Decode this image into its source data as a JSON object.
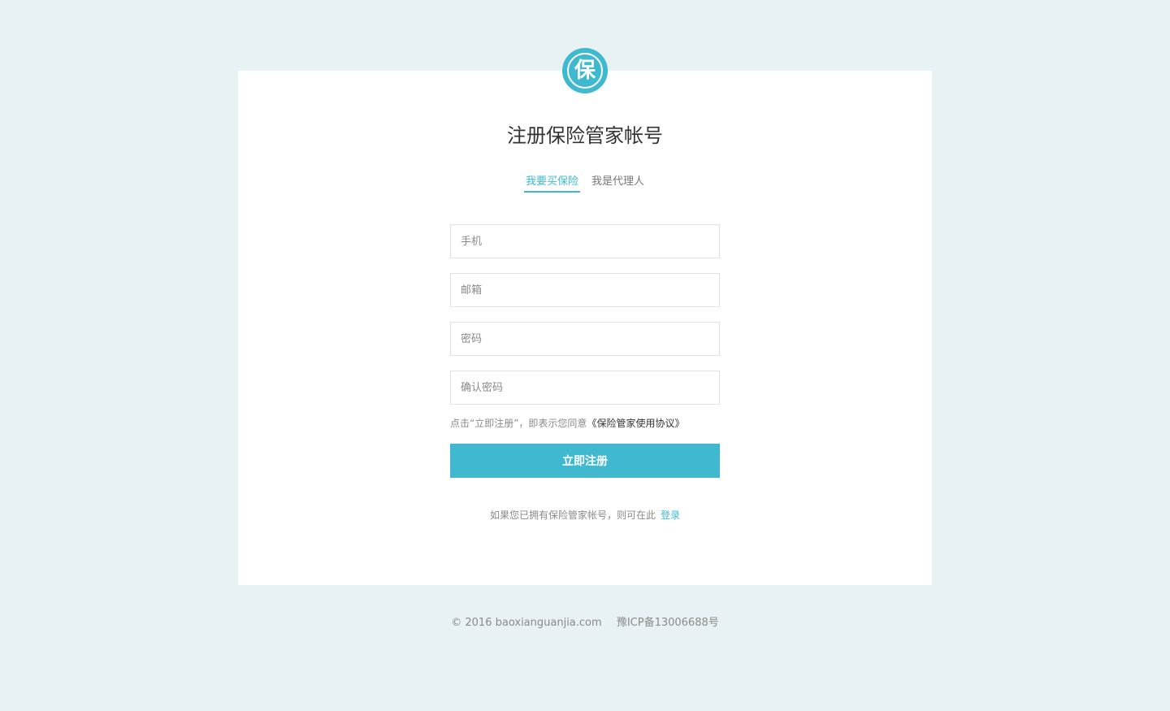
{
  "logo": {
    "char": "保",
    "icon": "shield-bao-logo",
    "color": "#3fb9cf"
  },
  "title": "注册保险管家帐号",
  "tabs": [
    {
      "label": "我要买保险",
      "active": true
    },
    {
      "label": "我是代理人",
      "active": false
    }
  ],
  "form": {
    "phone_placeholder": "手机",
    "email_placeholder": "邮箱",
    "password_placeholder": "密码",
    "confirm_placeholder": "确认密码"
  },
  "agreement": {
    "prefix": "点击“立即注册”，即表示您同意",
    "link": "《保险管家使用协议》"
  },
  "submit_label": "立即注册",
  "login_prompt": {
    "text": "如果您已拥有保险管家帐号，则可在此",
    "link": "登录"
  },
  "footer": {
    "copyright": "© 2016 baoxianguanjia.com",
    "icp": "豫ICP备13006688号"
  },
  "colors": {
    "accent": "#40b9d0",
    "background": "#e8f1f4"
  }
}
